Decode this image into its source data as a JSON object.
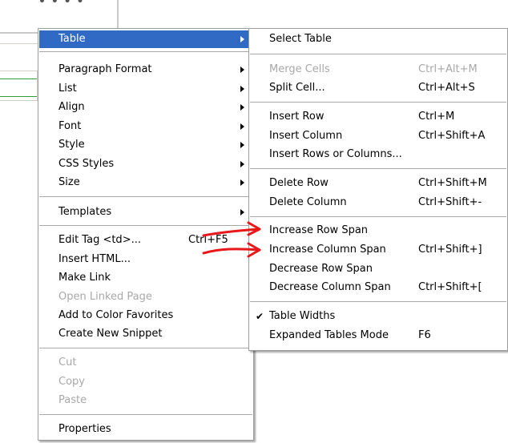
{
  "background": {
    "fragment_text": "• • • •"
  },
  "main_menu": {
    "items": [
      {
        "label": "Table",
        "submenu": true,
        "highlight": true
      },
      {
        "label": "Paragraph Format",
        "submenu": true
      },
      {
        "label": "List",
        "submenu": true
      },
      {
        "label": "Align",
        "submenu": true
      },
      {
        "label": "Font",
        "submenu": true
      },
      {
        "label": "Style",
        "submenu": true
      },
      {
        "label": "CSS Styles",
        "submenu": true
      },
      {
        "label": "Size",
        "submenu": true
      },
      {
        "label": "Templates",
        "submenu": true
      },
      {
        "label": "Edit Tag <td>...",
        "shortcut": "Ctrl+F5"
      },
      {
        "label": "Insert HTML..."
      },
      {
        "label": "Make Link"
      },
      {
        "label": "Open Linked Page",
        "disabled": true
      },
      {
        "label": "Add to Color Favorites"
      },
      {
        "label": "Create New Snippet"
      },
      {
        "label": "Cut",
        "disabled": true
      },
      {
        "label": "Copy",
        "disabled": true
      },
      {
        "label": "Paste",
        "disabled": true
      },
      {
        "label": "Properties"
      }
    ]
  },
  "sub_menu": {
    "items": [
      {
        "label": "Select Table"
      },
      {
        "label": "Merge Cells",
        "shortcut": "Ctrl+Alt+M",
        "disabled": true
      },
      {
        "label": "Split Cell...",
        "shortcut": "Ctrl+Alt+S"
      },
      {
        "label": "Insert Row",
        "shortcut": "Ctrl+M"
      },
      {
        "label": "Insert Column",
        "shortcut": "Ctrl+Shift+A"
      },
      {
        "label": "Insert Rows or Columns..."
      },
      {
        "label": "Delete Row",
        "shortcut": "Ctrl+Shift+M"
      },
      {
        "label": "Delete Column",
        "shortcut": "Ctrl+Shift+-"
      },
      {
        "label": "Increase Row Span"
      },
      {
        "label": "Increase Column Span",
        "shortcut": "Ctrl+Shift+]"
      },
      {
        "label": "Decrease Row Span"
      },
      {
        "label": "Decrease Column Span",
        "shortcut": "Ctrl+Shift+["
      },
      {
        "label": "Table Widths",
        "checked": true
      },
      {
        "label": "Expanded Tables Mode",
        "shortcut": "F6"
      }
    ]
  },
  "colors": {
    "highlight": "#316ac5",
    "disabled": "#a8a8a8",
    "annotation": "#e8171a",
    "accent_line": "#2e9c3c"
  }
}
